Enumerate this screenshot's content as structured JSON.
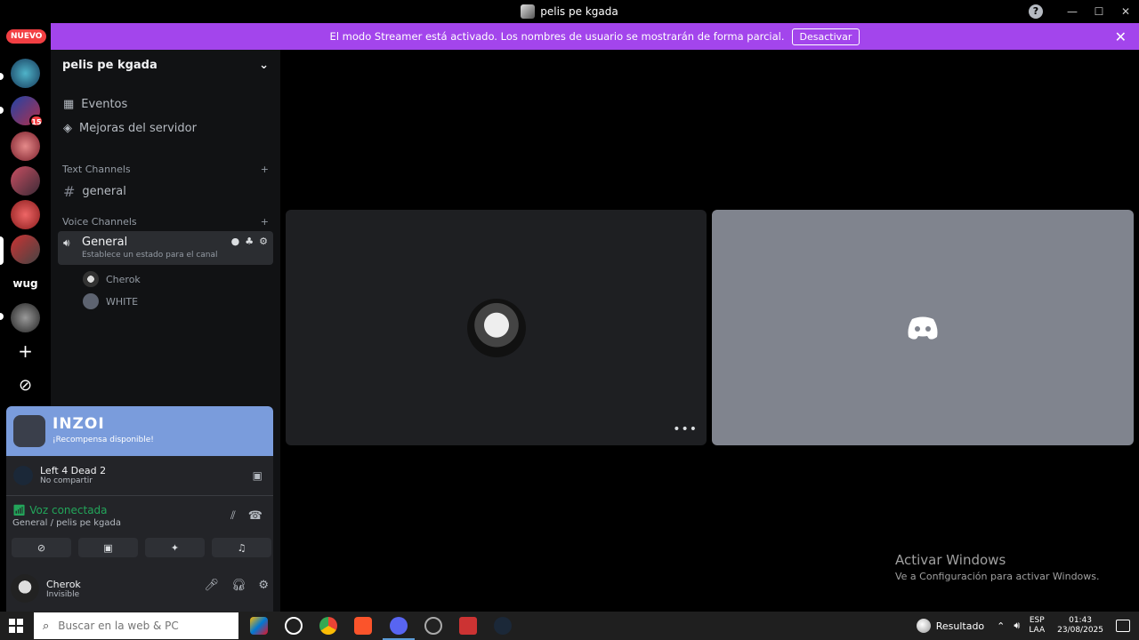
{
  "window": {
    "title": "pelis pe kgada",
    "controls": [
      "?",
      "—",
      "☐",
      "✕"
    ]
  },
  "rail": {
    "nuevo": "NUEVO",
    "badge_count": "15",
    "wug_label": "wug",
    "add_server": "+",
    "explore": "⊘"
  },
  "banner": {
    "message": "El modo Streamer está activado. Los nombres de usuario se mostrarán de forma parcial.",
    "button": "Desactivar",
    "close": "✕",
    "color": "#a345ec"
  },
  "sidebar": {
    "server_name": "pelis pe kgada",
    "nav": [
      {
        "label": "Eventos",
        "icon": "calendar-icon"
      },
      {
        "label": "Mejoras del servidor",
        "icon": "boost-icon"
      }
    ],
    "text_category": "Text Channels",
    "text_channels": [
      {
        "label": "general"
      }
    ],
    "voice_category": "Voice Channels",
    "voice_channel": {
      "name": "General",
      "status": "Establece un estado para el canal"
    },
    "members": [
      {
        "name": "Cherok"
      },
      {
        "name": "WHITE"
      }
    ]
  },
  "promo": {
    "logo": "INZOI",
    "subtitle": "¡Recompensa disponible!",
    "color": "#7a9cdc"
  },
  "activity": {
    "game": "Left 4 Dead 2",
    "status": "No compartir"
  },
  "voice": {
    "label": "Voz conectada",
    "location": "General / pelis pe kgada",
    "color": "#23a55a"
  },
  "user": {
    "name": "Cherok",
    "status": "Invisible"
  },
  "watermark": {
    "line1": "Activar Windows",
    "line2": "Ve a Configuración para activar Windows."
  },
  "taskbar": {
    "search_placeholder": "Buscar en la web & PC",
    "weather": "Resultado",
    "lang1": "ESP",
    "lang2": "LAA",
    "time": "01:43",
    "date": "23/08/2025"
  }
}
